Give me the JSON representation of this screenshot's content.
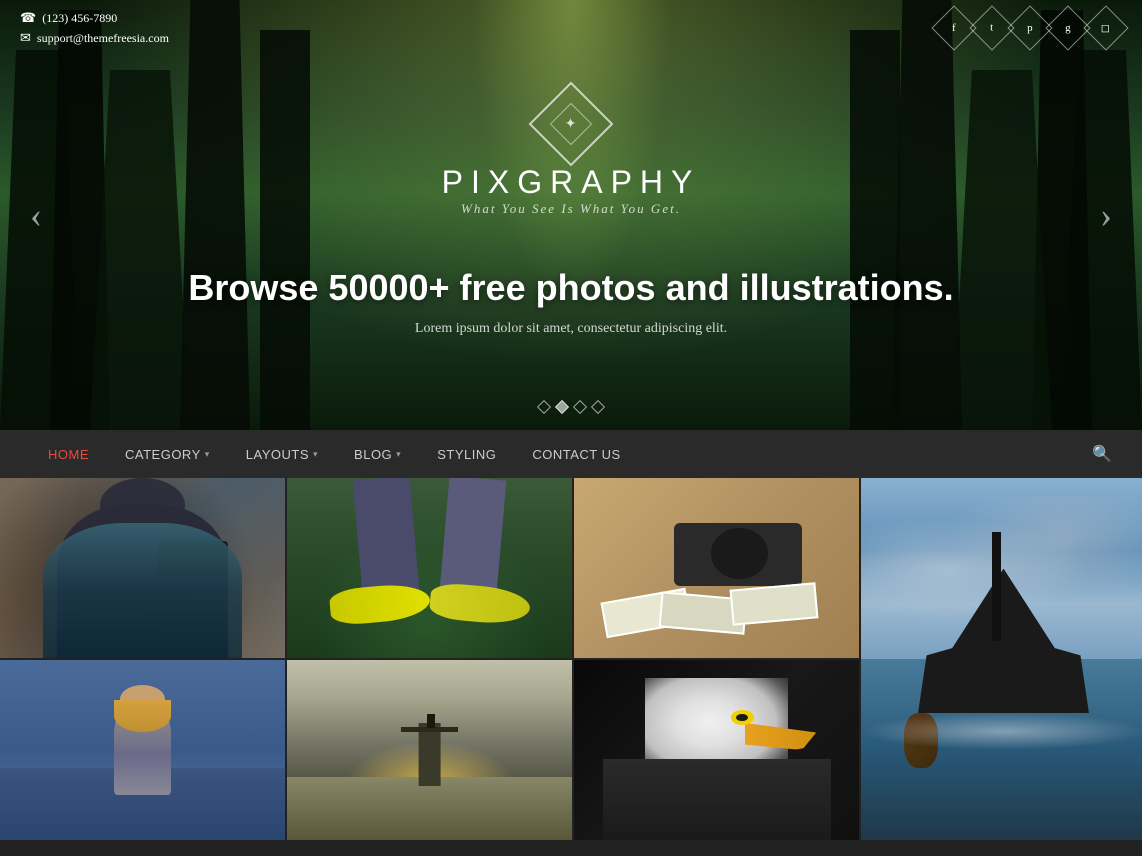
{
  "contact": {
    "phone": "(123) 456-7890",
    "email": "support@themefreesia.com"
  },
  "social": [
    {
      "name": "facebook",
      "icon": "f"
    },
    {
      "name": "twitter",
      "icon": "t"
    },
    {
      "name": "pinterest",
      "icon": "p"
    },
    {
      "name": "google-plus",
      "icon": "g+"
    },
    {
      "name": "instagram",
      "icon": "in"
    }
  ],
  "logo": {
    "symbol": "✕",
    "title": "PIXGRAPHY",
    "tagline": "What You See Is What You Get."
  },
  "hero": {
    "headline": "Browse 50000+ free photos and illustrations.",
    "subtext": "Lorem ipsum dolor sit amet, consectetur adipiscing elit.",
    "dots": [
      false,
      true,
      false,
      false
    ]
  },
  "nav": {
    "items": [
      {
        "label": "HOME",
        "active": true,
        "hasDropdown": false
      },
      {
        "label": "CATEGORY",
        "active": false,
        "hasDropdown": true
      },
      {
        "label": "LAYOUTS",
        "active": false,
        "hasDropdown": true
      },
      {
        "label": "BLOG",
        "active": false,
        "hasDropdown": true
      },
      {
        "label": "STYLING",
        "active": false,
        "hasDropdown": false
      },
      {
        "label": "CONTACT US",
        "active": false,
        "hasDropdown": false
      }
    ]
  },
  "photos": [
    {
      "id": 1,
      "style": "camera",
      "tall": false
    },
    {
      "id": 2,
      "style": "shoes",
      "tall": false
    },
    {
      "id": 3,
      "style": "camera2",
      "tall": false
    },
    {
      "id": 4,
      "style": "ship",
      "tall": true
    },
    {
      "id": 5,
      "style": "person",
      "tall": false
    },
    {
      "id": 6,
      "style": "sea",
      "tall": false
    },
    {
      "id": 7,
      "style": "eagle",
      "tall": false
    }
  ]
}
